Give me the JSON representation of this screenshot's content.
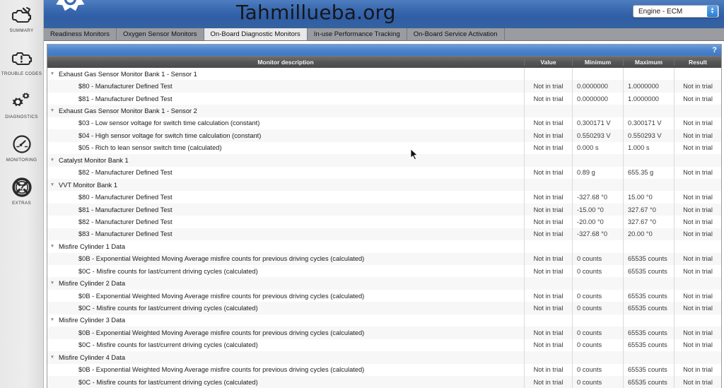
{
  "app": {
    "watermark": "Tahmillueba.org",
    "accent_blue": "#3a6ab0",
    "header_gray": "#555555"
  },
  "sidebar": {
    "items": [
      {
        "label": "SUMMARY",
        "icon": "engine-check-slash-icon"
      },
      {
        "label": "TROUBLE CODES",
        "icon": "engine-exclamation-icon"
      },
      {
        "label": "DIAGNOSTICS",
        "icon": "gears-icon"
      },
      {
        "label": "MONITORING",
        "icon": "gauge-icon"
      },
      {
        "label": "EXTRAS",
        "icon": "question-life-ring-icon"
      }
    ]
  },
  "header": {
    "ecu_select": {
      "value": "Engine - ECM",
      "icon": "up-down-arrows-icon"
    },
    "logo_icon": "gears-logo-icon"
  },
  "tabs": [
    {
      "label": "Readiness Monitors",
      "selected": false
    },
    {
      "label": "Oxygen Sensor Monitors",
      "selected": false
    },
    {
      "label": "On-Board Diagnostic Monitors",
      "selected": true
    },
    {
      "label": "In-use Performance Tracking",
      "selected": false
    },
    {
      "label": "On-Board Service Activation",
      "selected": false
    }
  ],
  "toolbar": {
    "help_label": "?"
  },
  "table": {
    "columns": [
      "Monitor description",
      "Value",
      "Minimum",
      "Maximum",
      "Result"
    ],
    "rows": [
      {
        "type": "group",
        "desc": "Exhaust Gas Sensor Monitor Bank 1 - Sensor 1",
        "value": "",
        "min": "",
        "max": "",
        "result": ""
      },
      {
        "type": "child",
        "desc": "$80 - Manufacturer Defined Test",
        "value": "Not in trial",
        "min": "0.0000000",
        "max": "1.0000000",
        "result": "Not in trial"
      },
      {
        "type": "child",
        "desc": "$81 - Manufacturer Defined Test",
        "value": "Not in trial",
        "min": "0.0000000",
        "max": "1.0000000",
        "result": "Not in trial"
      },
      {
        "type": "group",
        "desc": "Exhaust Gas Sensor Monitor Bank 1 - Sensor 2",
        "value": "",
        "min": "",
        "max": "",
        "result": ""
      },
      {
        "type": "child",
        "desc": "$03 - Low sensor voltage for switch time calculation (constant)",
        "value": "Not in trial",
        "min": "0.300171 V",
        "max": "0.300171 V",
        "result": "Not in trial"
      },
      {
        "type": "child",
        "desc": "$04 - High sensor voltage for switch time calculation (constant)",
        "value": "Not in trial",
        "min": "0.550293 V",
        "max": "0.550293 V",
        "result": "Not in trial"
      },
      {
        "type": "child",
        "desc": "$05 - Rich to lean sensor switch time (calculated)",
        "value": "Not in trial",
        "min": "0.000 s",
        "max": "1.000 s",
        "result": "Not in trial"
      },
      {
        "type": "group",
        "desc": "Catalyst Monitor Bank 1",
        "value": "",
        "min": "",
        "max": "",
        "result": ""
      },
      {
        "type": "child",
        "desc": "$82 - Manufacturer Defined Test",
        "value": "Not in trial",
        "min": "0.89 g",
        "max": "655.35 g",
        "result": "Not in trial"
      },
      {
        "type": "group",
        "desc": "VVT Monitor Bank 1",
        "value": "",
        "min": "",
        "max": "",
        "result": ""
      },
      {
        "type": "child",
        "desc": "$80 - Manufacturer Defined Test",
        "value": "Not in trial",
        "min": "-327.68 °0",
        "max": "15.00 °0",
        "result": "Not in trial"
      },
      {
        "type": "child",
        "desc": "$81 - Manufacturer Defined Test",
        "value": "Not in trial",
        "min": "-15.00 °0",
        "max": "327.67 °0",
        "result": "Not in trial"
      },
      {
        "type": "child",
        "desc": "$82 - Manufacturer Defined Test",
        "value": "Not in trial",
        "min": "-20.00 °0",
        "max": "327.67 °0",
        "result": "Not in trial"
      },
      {
        "type": "child",
        "desc": "$83 - Manufacturer Defined Test",
        "value": "Not in trial",
        "min": "-327.68 °0",
        "max": "20.00 °0",
        "result": "Not in trial"
      },
      {
        "type": "group",
        "desc": "Misfire Cylinder 1 Data",
        "value": "",
        "min": "",
        "max": "",
        "result": ""
      },
      {
        "type": "child",
        "desc": "$0B - Exponential Weighted Moving Average misfire counts for previous driving cycles (calculated)",
        "value": "Not in trial",
        "min": "0 counts",
        "max": "65535 counts",
        "result": "Not in trial"
      },
      {
        "type": "child",
        "desc": "$0C - Misfire counts for last/current driving cycles (calculated)",
        "value": "Not in trial",
        "min": "0 counts",
        "max": "65535 counts",
        "result": "Not in trial"
      },
      {
        "type": "group",
        "desc": "Misfire Cylinder 2 Data",
        "value": "",
        "min": "",
        "max": "",
        "result": ""
      },
      {
        "type": "child",
        "desc": "$0B - Exponential Weighted Moving Average misfire counts for previous driving cycles (calculated)",
        "value": "Not in trial",
        "min": "0 counts",
        "max": "65535 counts",
        "result": "Not in trial"
      },
      {
        "type": "child",
        "desc": "$0C - Misfire counts for last/current driving cycles (calculated)",
        "value": "Not in trial",
        "min": "0 counts",
        "max": "65535 counts",
        "result": "Not in trial"
      },
      {
        "type": "group",
        "desc": "Misfire Cylinder 3 Data",
        "value": "",
        "min": "",
        "max": "",
        "result": ""
      },
      {
        "type": "child",
        "desc": "$0B - Exponential Weighted Moving Average misfire counts for previous driving cycles (calculated)",
        "value": "Not in trial",
        "min": "0 counts",
        "max": "65535 counts",
        "result": "Not in trial"
      },
      {
        "type": "child",
        "desc": "$0C - Misfire counts for last/current driving cycles (calculated)",
        "value": "Not in trial",
        "min": "0 counts",
        "max": "65535 counts",
        "result": "Not in trial"
      },
      {
        "type": "group",
        "desc": "Misfire Cylinder 4 Data",
        "value": "",
        "min": "",
        "max": "",
        "result": ""
      },
      {
        "type": "child",
        "desc": "$0B - Exponential Weighted Moving Average misfire counts for previous driving cycles (calculated)",
        "value": "Not in trial",
        "min": "0 counts",
        "max": "65535 counts",
        "result": "Not in trial"
      },
      {
        "type": "child",
        "desc": "$0C - Misfire counts for last/current driving cycles (calculated)",
        "value": "Not in trial",
        "min": "0 counts",
        "max": "65535 counts",
        "result": "Not in trial"
      }
    ],
    "expander_glyph": "▼"
  }
}
